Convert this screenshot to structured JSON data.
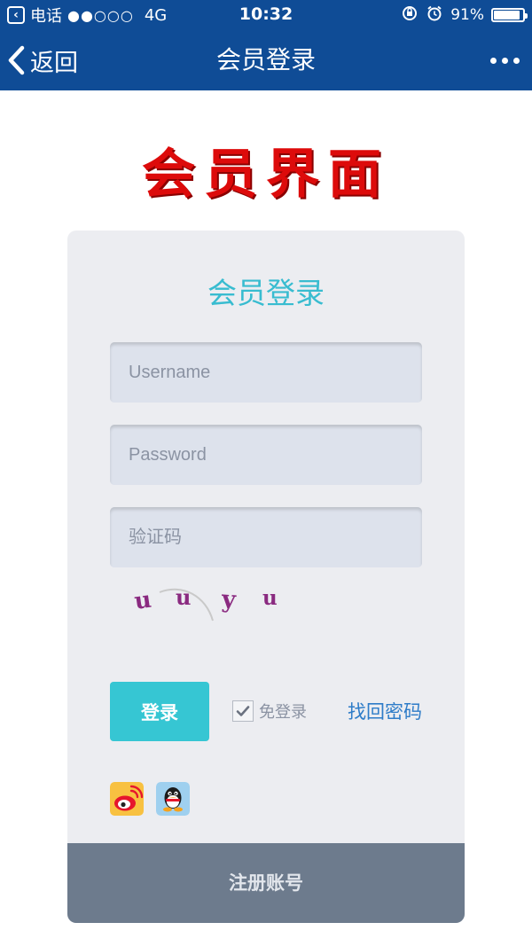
{
  "status_bar": {
    "back_app_label": "电话",
    "signal": "●●○○○",
    "network": "4G",
    "time": "10:32",
    "battery_text": "91%",
    "battery_level": 0.91,
    "icons": [
      "lock-rotation-icon",
      "alarm-icon",
      "battery-icon"
    ]
  },
  "nav": {
    "back_label": "返回",
    "title": "会员登录",
    "more_icon": "more-dots-icon"
  },
  "banner": {
    "text": "会员界面"
  },
  "login": {
    "title": "会员登录",
    "username_placeholder": "Username",
    "password_placeholder": "Password",
    "captcha_placeholder": "验证码",
    "captcha_chars": [
      "u",
      "u",
      "y",
      "u"
    ],
    "login_button": "登录",
    "remember_label": "免登录",
    "remember_checked": true,
    "forgot_link": "找回密码",
    "social": [
      "weibo-icon",
      "qq-icon"
    ],
    "register_label": "注册账号"
  },
  "colors": {
    "header_bg": "#0f4c96",
    "banner_red": "#dd0b0b",
    "title_teal": "#38bcd0",
    "login_button": "#36c6d3",
    "link_blue": "#2e7cc8",
    "register_bg": "#6d7b8d",
    "card_bg": "#ecedf1",
    "captcha_purple": "#8a2a80"
  }
}
